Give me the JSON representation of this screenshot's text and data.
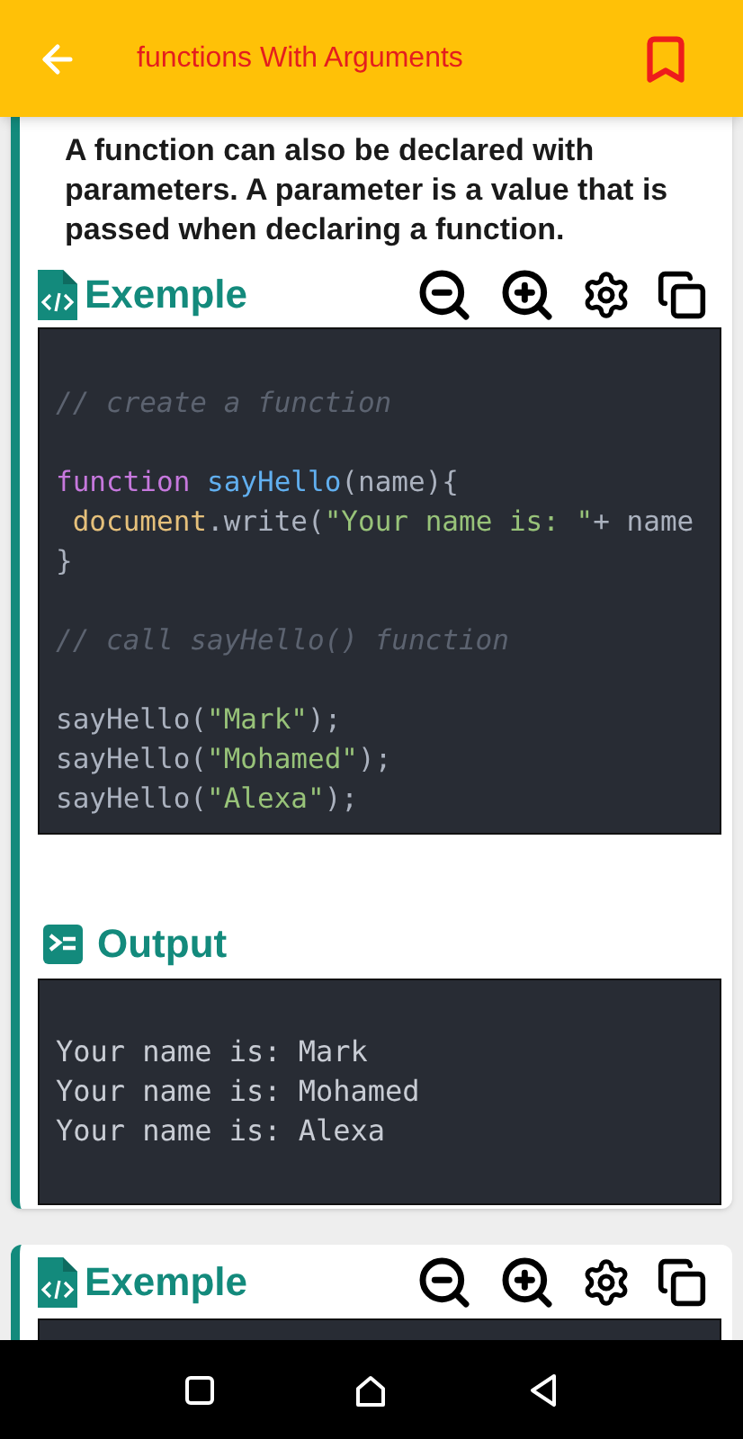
{
  "app_bar": {
    "title": "functions With Arguments"
  },
  "lesson": {
    "description": "A function can also be declared with parameters. A parameter is a value that is passed when declaring a function.",
    "example": {
      "heading": "Exemple",
      "lines": [
        {
          "kind": "blank"
        },
        {
          "kind": "code",
          "tokens": [
            {
              "kind": "comment",
              "text": "// create a function"
            }
          ]
        },
        {
          "kind": "blank"
        },
        {
          "kind": "code",
          "tokens": [
            {
              "kind": "keyword",
              "text": "function "
            },
            {
              "kind": "function",
              "text": "sayHello"
            },
            {
              "kind": "plain",
              "text": "(name){"
            }
          ]
        },
        {
          "kind": "code",
          "tokens": [
            {
              "kind": "object",
              "text": " document"
            },
            {
              "kind": "plain",
              "text": ".write("
            },
            {
              "kind": "string",
              "text": "\"Your name is: \""
            },
            {
              "kind": "plain",
              "text": "+ name"
            }
          ]
        },
        {
          "kind": "code",
          "tokens": [
            {
              "kind": "plain",
              "text": "}"
            }
          ]
        },
        {
          "kind": "blank"
        },
        {
          "kind": "code",
          "tokens": [
            {
              "kind": "comment",
              "text": "// call sayHello() function"
            }
          ]
        },
        {
          "kind": "blank"
        },
        {
          "kind": "code",
          "tokens": [
            {
              "kind": "plain",
              "text": "sayHello("
            },
            {
              "kind": "string",
              "text": "\"Mark\""
            },
            {
              "kind": "plain",
              "text": ");"
            }
          ]
        },
        {
          "kind": "code",
          "tokens": [
            {
              "kind": "plain",
              "text": "sayHello("
            },
            {
              "kind": "string",
              "text": "\"Mohamed\""
            },
            {
              "kind": "plain",
              "text": ");"
            }
          ]
        },
        {
          "kind": "code",
          "tokens": [
            {
              "kind": "plain",
              "text": "sayHello("
            },
            {
              "kind": "string",
              "text": "\"Alexa\""
            },
            {
              "kind": "plain",
              "text": ");"
            }
          ]
        }
      ]
    },
    "output": {
      "heading": "Output",
      "lines": [
        "Your name is: Mark",
        "Your name is: Mohamed",
        "Your name is: Alexa"
      ]
    }
  },
  "next_card": {
    "heading": "Exemple"
  }
}
